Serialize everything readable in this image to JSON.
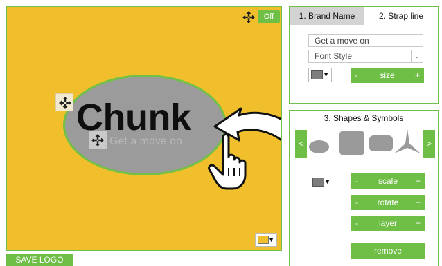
{
  "colors": {
    "canvas_bg": "#f0bf2b",
    "accent_green": "#6fbe46",
    "ellipse_fill": "#9b9b9b",
    "ellipse_stroke": "#70c145",
    "strap_text": "#b8b8b8",
    "logo_text": "#0f0f0f",
    "swatch_gray": "#7d7d7d",
    "swatch_yellow": "#f0bf2b"
  },
  "canvas": {
    "toggle_label": "Off",
    "logo_text": "Chunk",
    "strap_text": "Get a move on",
    "move_icon": "move-arrows-icon",
    "pointer_icon": "hand-pointer-icon"
  },
  "save_logo_label": "SAVE LOGO",
  "text_panel": {
    "tabs": [
      {
        "label": "1. Brand Name",
        "active": false
      },
      {
        "label": "2. Strap line",
        "active": true
      }
    ],
    "strap_input_value": "Get a move on",
    "font_select": "Font Style",
    "size_label": "size",
    "minus": "-",
    "plus": "+",
    "caret": "▼"
  },
  "shapes_panel": {
    "title": "3. Shapes & Symbols",
    "prev": "<",
    "next": ">",
    "shapes": [
      "ellipse",
      "rounded-square",
      "rounded-rectangle",
      "three-point-star"
    ],
    "scale_label": "scale",
    "rotate_label": "rotate",
    "layer_label": "layer",
    "remove_label": "remove"
  }
}
